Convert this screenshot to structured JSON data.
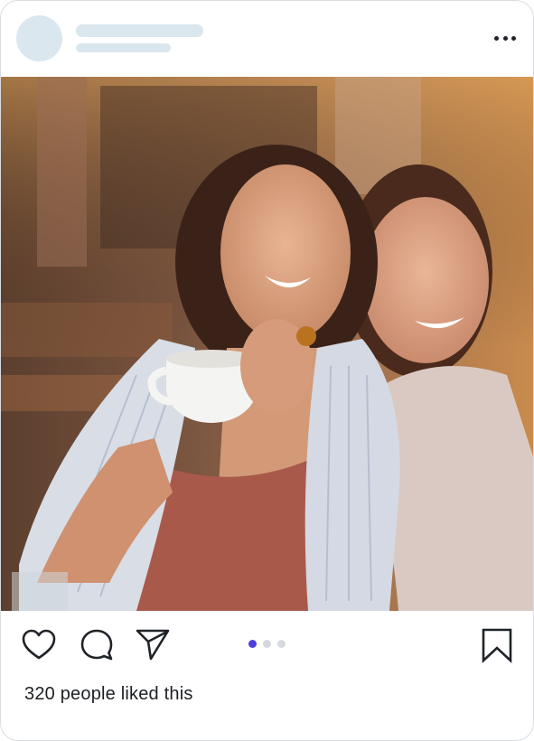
{
  "post": {
    "likes_text": "320 people liked this",
    "carousel": {
      "count": 3,
      "active_index": 0
    }
  },
  "colors": {
    "skeleton": "#dbe7ee",
    "accent": "#4c3fe0",
    "icon_stroke": "#1f2328",
    "dot_inactive": "#d6d9dd"
  },
  "icons": {
    "more": "more-dots-icon",
    "like": "heart-icon",
    "comment": "comment-bubble-icon",
    "share": "paper-plane-icon",
    "save": "bookmark-icon"
  }
}
